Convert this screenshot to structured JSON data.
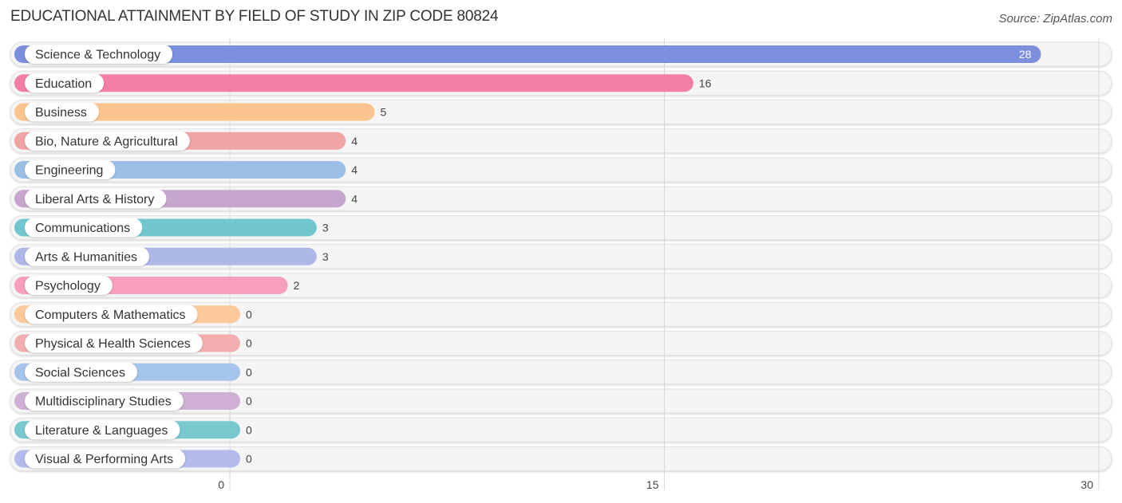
{
  "title": "EDUCATIONAL ATTAINMENT BY FIELD OF STUDY IN ZIP CODE 80824",
  "source": "Source: ZipAtlas.com",
  "chart_data": {
    "type": "bar",
    "orientation": "horizontal",
    "title": "EDUCATIONAL ATTAINMENT BY FIELD OF STUDY IN ZIP CODE 80824",
    "xlabel": "",
    "ylabel": "",
    "xlim": [
      0,
      30
    ],
    "xticks": [
      0,
      15,
      30
    ],
    "grid": true,
    "legend": "none",
    "categories": [
      "Science & Technology",
      "Education",
      "Business",
      "Bio, Nature & Agricultural",
      "Engineering",
      "Liberal Arts & History",
      "Communications",
      "Arts & Humanities",
      "Psychology",
      "Computers & Mathematics",
      "Physical & Health Sciences",
      "Social Sciences",
      "Multidisciplinary Studies",
      "Literature & Languages",
      "Visual & Performing Arts"
    ],
    "values": [
      28,
      16,
      5,
      4,
      4,
      4,
      3,
      3,
      2,
      0,
      0,
      0,
      0,
      0,
      0
    ],
    "colors": [
      "#7b8fdc",
      "#f47fa4",
      "#fbc48e",
      "#f0a4a4",
      "#9bbfe6",
      "#c6a6cc",
      "#72c7cf",
      "#adb7e8",
      "#f79fbc",
      "#fbc99a",
      "#f2aeae",
      "#a4c4ec",
      "#cdb0d4",
      "#78c8ce",
      "#b3bbec"
    ]
  }
}
